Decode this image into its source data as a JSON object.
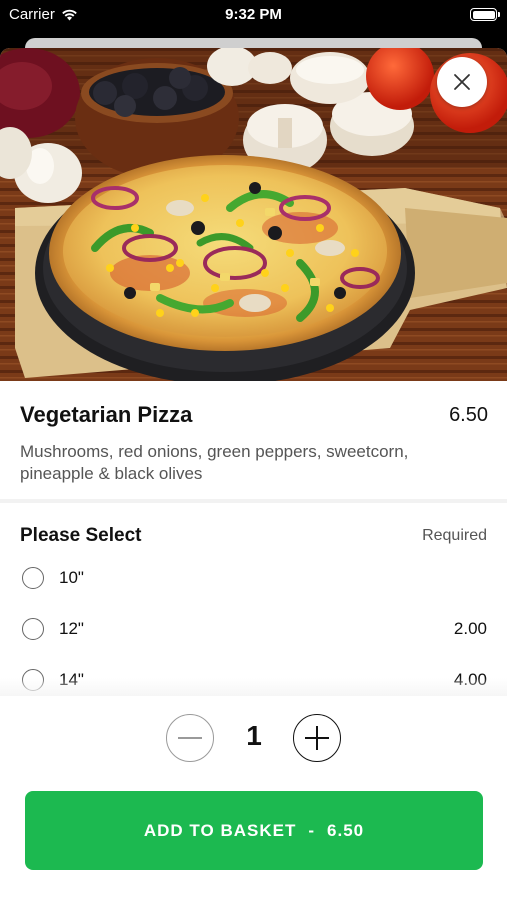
{
  "status_bar": {
    "carrier": "Carrier",
    "time": "9:32 PM",
    "icons": [
      "wifi-icon",
      "battery-icon"
    ]
  },
  "hero": {
    "image": "pizza-photo",
    "close_icon": "close-icon"
  },
  "item": {
    "name": "Vegetarian Pizza",
    "price": "6.50",
    "description": "Mushrooms, red onions, green peppers, sweetcorn, pineapple & black olives"
  },
  "options": {
    "title": "Please Select",
    "required_label": "Required",
    "items": [
      {
        "label": "10\"",
        "price": ""
      },
      {
        "label": "12\"",
        "price": "2.00"
      },
      {
        "label": "14\"",
        "price": "4.00"
      }
    ]
  },
  "quantity": {
    "value": "1",
    "minus_icon": "minus-icon",
    "plus_icon": "plus-icon"
  },
  "add_button": {
    "label": "ADD TO BASKET",
    "separator": "-",
    "total": "6.50"
  },
  "colors": {
    "accent_green": "#1cb950",
    "text_primary": "#111111",
    "text_secondary": "#555555"
  }
}
